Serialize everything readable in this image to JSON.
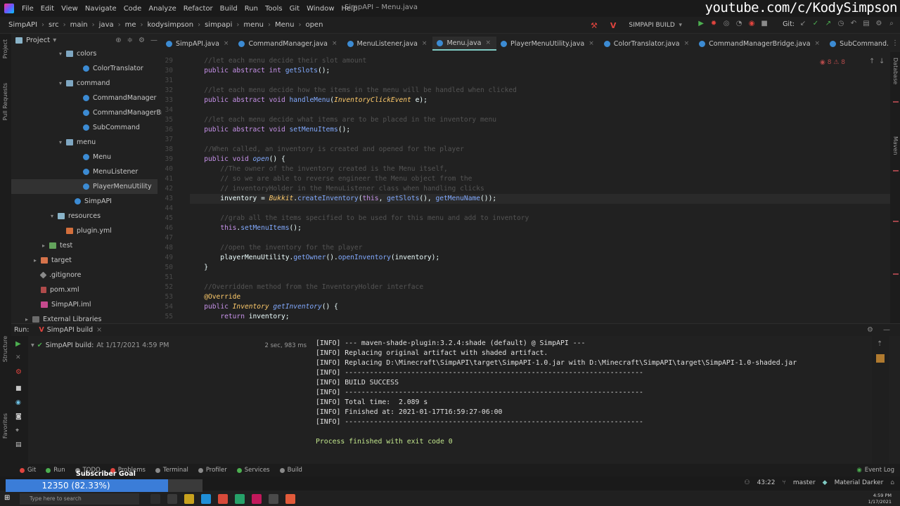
{
  "menubar": {
    "items": [
      "File",
      "Edit",
      "View",
      "Navigate",
      "Code",
      "Analyze",
      "Refactor",
      "Build",
      "Run",
      "Tools",
      "Git",
      "Window",
      "Help"
    ],
    "title": "SimpAPI – Menu.java",
    "channel": "youtube.com/c/KodySimpson"
  },
  "navbar": {
    "crumbs": [
      "SimpAPI",
      "src",
      "main",
      "java",
      "me",
      "kodysimpson",
      "simpapi",
      "menu",
      "Menu",
      "open"
    ],
    "run_config": "SIMPAPI BUILD",
    "git_label": "Git:"
  },
  "project": {
    "title": "Project",
    "items": [
      {
        "label": "colors",
        "indent": 1,
        "kind": "pkg",
        "arrow": "▾"
      },
      {
        "label": "ColorTranslator",
        "indent": 3,
        "kind": "classic",
        "arrow": ""
      },
      {
        "label": "command",
        "indent": 1,
        "kind": "pkg",
        "arrow": "▾"
      },
      {
        "label": "CommandManager",
        "indent": 3,
        "kind": "classic",
        "arrow": ""
      },
      {
        "label": "CommandManagerBridg",
        "indent": 3,
        "kind": "classic",
        "arrow": ""
      },
      {
        "label": "SubCommand",
        "indent": 3,
        "kind": "classic",
        "arrow": ""
      },
      {
        "label": "menu",
        "indent": 1,
        "kind": "pkg",
        "arrow": "▾"
      },
      {
        "label": "Menu",
        "indent": 3,
        "kind": "classic",
        "arrow": ""
      },
      {
        "label": "MenuListener",
        "indent": 3,
        "kind": "classic",
        "arrow": ""
      },
      {
        "label": "PlayerMenuUtility",
        "indent": 3,
        "kind": "classic",
        "arrow": ""
      },
      {
        "label": "SimpAPI",
        "indent": 2,
        "kind": "classic",
        "arrow": ""
      },
      {
        "label": "resources",
        "indent": 0,
        "kind": "folder",
        "arrow": "▾"
      },
      {
        "label": "plugin.yml",
        "indent": 1,
        "kind": "yml",
        "arrow": ""
      },
      {
        "label": "test",
        "indent": -1,
        "kind": "green-folder",
        "arrow": "▸"
      },
      {
        "label": "target",
        "indent": -2,
        "kind": "red-folder",
        "arrow": "▸"
      },
      {
        "label": ".gitignore",
        "indent": -2,
        "kind": "git",
        "arrow": ""
      },
      {
        "label": "pom.xml",
        "indent": -2,
        "kind": "mvn",
        "arrow": ""
      },
      {
        "label": "SimpAPI.iml",
        "indent": -2,
        "kind": "iml",
        "arrow": ""
      },
      {
        "label": "External Libraries",
        "indent": -3,
        "kind": "libs",
        "arrow": "▸"
      }
    ]
  },
  "tabs": [
    {
      "label": "SimpAPI.java",
      "active": false
    },
    {
      "label": "CommandManager.java",
      "active": false
    },
    {
      "label": "MenuListener.java",
      "active": false
    },
    {
      "label": "Menu.java",
      "active": true
    },
    {
      "label": "PlayerMenuUtility.java",
      "active": false
    },
    {
      "label": "ColorTranslator.java",
      "active": false
    },
    {
      "label": "CommandManagerBridge.java",
      "active": false
    },
    {
      "label": "SubCommand.",
      "active": false
    }
  ],
  "editor": {
    "line_numbers": [
      "29",
      "30",
      "31",
      "32",
      "33",
      "34",
      "35",
      "36",
      "37",
      "38",
      "39",
      "40",
      "41",
      "42",
      "43",
      "44",
      "45",
      "46",
      "47",
      "48",
      "49",
      "50",
      "51",
      "52",
      "53",
      "54",
      "55"
    ],
    "current_line_index": 14,
    "lines": [
      [
        {
          "t": "        //let each menu decide their slot amount",
          "c": "cmt"
        }
      ],
      [
        {
          "t": "        ",
          "c": ""
        },
        {
          "t": "public abstract int ",
          "c": "kw"
        },
        {
          "t": "getSlots",
          "c": "fn"
        },
        {
          "t": "();",
          "c": ""
        }
      ],
      [
        {
          "t": "",
          "c": ""
        }
      ],
      [
        {
          "t": "        //let each menu decide how the items in the menu will be handled when clicked",
          "c": "cmt"
        }
      ],
      [
        {
          "t": "        ",
          "c": ""
        },
        {
          "t": "public abstract void ",
          "c": "kw"
        },
        {
          "t": "handleMenu",
          "c": "fn"
        },
        {
          "t": "(",
          "c": ""
        },
        {
          "t": "InventoryClickEvent",
          "c": "ty"
        },
        {
          "t": " e);",
          "c": ""
        }
      ],
      [
        {
          "t": "",
          "c": ""
        }
      ],
      [
        {
          "t": "        //let each menu decide what items are to be placed in the inventory menu",
          "c": "cmt"
        }
      ],
      [
        {
          "t": "        ",
          "c": ""
        },
        {
          "t": "public abstract void ",
          "c": "kw"
        },
        {
          "t": "setMenuItems",
          "c": "fn"
        },
        {
          "t": "();",
          "c": ""
        }
      ],
      [
        {
          "t": "",
          "c": ""
        }
      ],
      [
        {
          "t": "        //When called, an inventory is created and opened for the player",
          "c": "cmt"
        }
      ],
      [
        {
          "t": "        ",
          "c": ""
        },
        {
          "t": "public void ",
          "c": "kw"
        },
        {
          "t": "open",
          "c": "fn it"
        },
        {
          "t": "() {",
          "c": ""
        }
      ],
      [
        {
          "t": "            //The owner of the inventory created is the Menu itself,",
          "c": "cmt"
        }
      ],
      [
        {
          "t": "            // so we are able to reverse engineer the Menu object from the",
          "c": "cmt"
        }
      ],
      [
        {
          "t": "            // inventoryHolder in the MenuListener class when handling clicks",
          "c": "cmt"
        }
      ],
      [
        {
          "t": "            inventory = ",
          "c": ""
        },
        {
          "t": "Bukkit",
          "c": "ty"
        },
        {
          "t": ".",
          "c": ""
        },
        {
          "t": "createInventory",
          "c": "fn"
        },
        {
          "t": "(",
          "c": ""
        },
        {
          "t": "this",
          "c": "kw"
        },
        {
          "t": ", ",
          "c": ""
        },
        {
          "t": "getSlots",
          "c": "fn"
        },
        {
          "t": "(), ",
          "c": ""
        },
        {
          "t": "getMenuName",
          "c": "fn"
        },
        {
          "t": "());",
          "c": ""
        }
      ],
      [
        {
          "t": "",
          "c": ""
        }
      ],
      [
        {
          "t": "            //grab all the items specified to be used for this menu and add to inventory",
          "c": "cmt"
        }
      ],
      [
        {
          "t": "            ",
          "c": ""
        },
        {
          "t": "this",
          "c": "kw"
        },
        {
          "t": ".",
          "c": ""
        },
        {
          "t": "setMenuItems",
          "c": "fn"
        },
        {
          "t": "();",
          "c": ""
        }
      ],
      [
        {
          "t": "",
          "c": ""
        }
      ],
      [
        {
          "t": "            //open the inventory for the player",
          "c": "cmt"
        }
      ],
      [
        {
          "t": "            playerMenuUtility.",
          "c": ""
        },
        {
          "t": "getOwner",
          "c": "fn"
        },
        {
          "t": "().",
          "c": ""
        },
        {
          "t": "openInventory",
          "c": "fn"
        },
        {
          "t": "(inventory);",
          "c": ""
        }
      ],
      [
        {
          "t": "        }",
          "c": ""
        }
      ],
      [
        {
          "t": "",
          "c": ""
        }
      ],
      [
        {
          "t": "        //Overridden method from the InventoryHolder interface",
          "c": "cmt"
        }
      ],
      [
        {
          "t": "        @Override",
          "c": "ann"
        }
      ],
      [
        {
          "t": "        ",
          "c": ""
        },
        {
          "t": "public ",
          "c": "kw"
        },
        {
          "t": "Inventory ",
          "c": "ty"
        },
        {
          "t": "getInventory",
          "c": "fn it"
        },
        {
          "t": "() {",
          "c": ""
        }
      ],
      [
        {
          "t": "            ",
          "c": ""
        },
        {
          "t": "return ",
          "c": "kw"
        },
        {
          "t": "inventory;",
          "c": ""
        }
      ]
    ]
  },
  "run": {
    "label": "Run:",
    "tab": "SimpAPI build",
    "build_entry": "SimpAPI build:",
    "build_time": "At 1/17/2021 4:59 PM",
    "duration": "2 sec, 983 ms",
    "console": [
      "[INFO] --- maven-shade-plugin:3.2.4:shade (default) @ SimpAPI ---",
      "[INFO] Replacing original artifact with shaded artifact.",
      "[INFO] Replacing D:\\Minecraft\\SimpAPI\\target\\SimpAPI-1.0.jar with D:\\Minecraft\\SimpAPI\\target\\SimpAPI-1.0-shaded.jar",
      "[INFO] ------------------------------------------------------------------------",
      "[INFO] BUILD SUCCESS",
      "[INFO] ------------------------------------------------------------------------",
      "[INFO] Total time:  2.089 s",
      "[INFO] Finished at: 2021-01-17T16:59:27-06:00",
      "[INFO] ------------------------------------------------------------------------",
      "",
      "Process finished with exit code 0"
    ]
  },
  "toolwindows": [
    {
      "label": "Git",
      "color": "#e0443e"
    },
    {
      "label": "Run",
      "color": "#4caf50"
    },
    {
      "label": "TODO",
      "color": "#8a8a8a"
    },
    {
      "label": "Problems",
      "color": "#e0443e"
    },
    {
      "label": "Terminal",
      "color": "#8a8a8a"
    },
    {
      "label": "Profiler",
      "color": "#8a8a8a"
    },
    {
      "label": "Services",
      "color": "#4caf50"
    },
    {
      "label": "Build",
      "color": "#8a8a8a"
    }
  ],
  "status": {
    "event_log": "Event Log",
    "position": "43:22",
    "branch": "master",
    "theme": "Material Darker"
  },
  "subscriber": {
    "label": "Subscriber Goal",
    "value": "12350 (82.33%)",
    "progress": 0.8233
  },
  "taskbar": {
    "search": "Type here to search",
    "time": "4:59 PM",
    "date": "1/17/2021"
  },
  "colors": {
    "accent": "#80cbc4",
    "keyword": "#c792ea",
    "function": "#82aaff",
    "type": "#ffcb6b",
    "comment": "#545454"
  }
}
